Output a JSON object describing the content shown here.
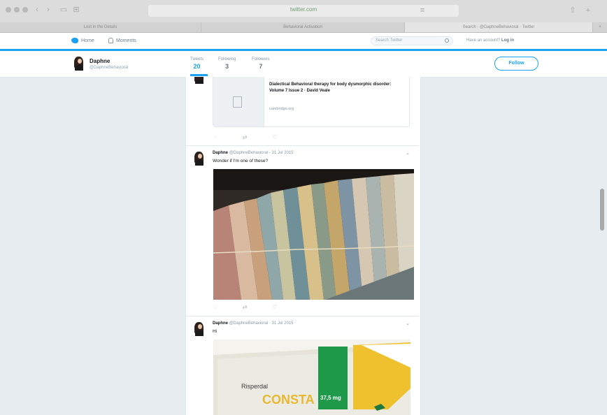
{
  "browser": {
    "url": "twitter.com",
    "tabs": [
      "Lost in the Details",
      "Behavioral Activation",
      "Search · @DaphneBehavioral · Twitter"
    ]
  },
  "twitter_nav": {
    "home_label": "Home",
    "notifications_label": "Moments",
    "search_placeholder": "Search Twitter",
    "account_prefix": "Have an account?",
    "account_login": "Log in"
  },
  "profile": {
    "name": "Daphne",
    "handle": "@DaphneBehavioral",
    "stats": [
      {
        "label": "Tweets",
        "value": "20"
      },
      {
        "label": "Following",
        "value": "3"
      },
      {
        "label": "Followers",
        "value": "7"
      }
    ],
    "follow_label": "Follow"
  },
  "tweets": [
    {
      "card_title": "Dialectical Behavioral therapy for body dysmorphic disorder: Volume 7 Issue 2 · David Veale",
      "card_domain": "cambridge.org"
    },
    {
      "name": "Daphne",
      "handle": "@DaphneBehavioral",
      "date": "· 31 Jul 2015",
      "text": "Wonder if I'm one of these?"
    },
    {
      "name": "Daphne",
      "handle": "@DaphneBehavioral",
      "date": "· 31 Jul 2015",
      "text": "Hi"
    }
  ],
  "pill_box": {
    "brand": "Risperdal",
    "product": "CONSTA",
    "dose": "37,5 mg"
  },
  "colors": {
    "twitter_blue": "#1da1f2",
    "timeline_bg": "#e6ecf0"
  }
}
